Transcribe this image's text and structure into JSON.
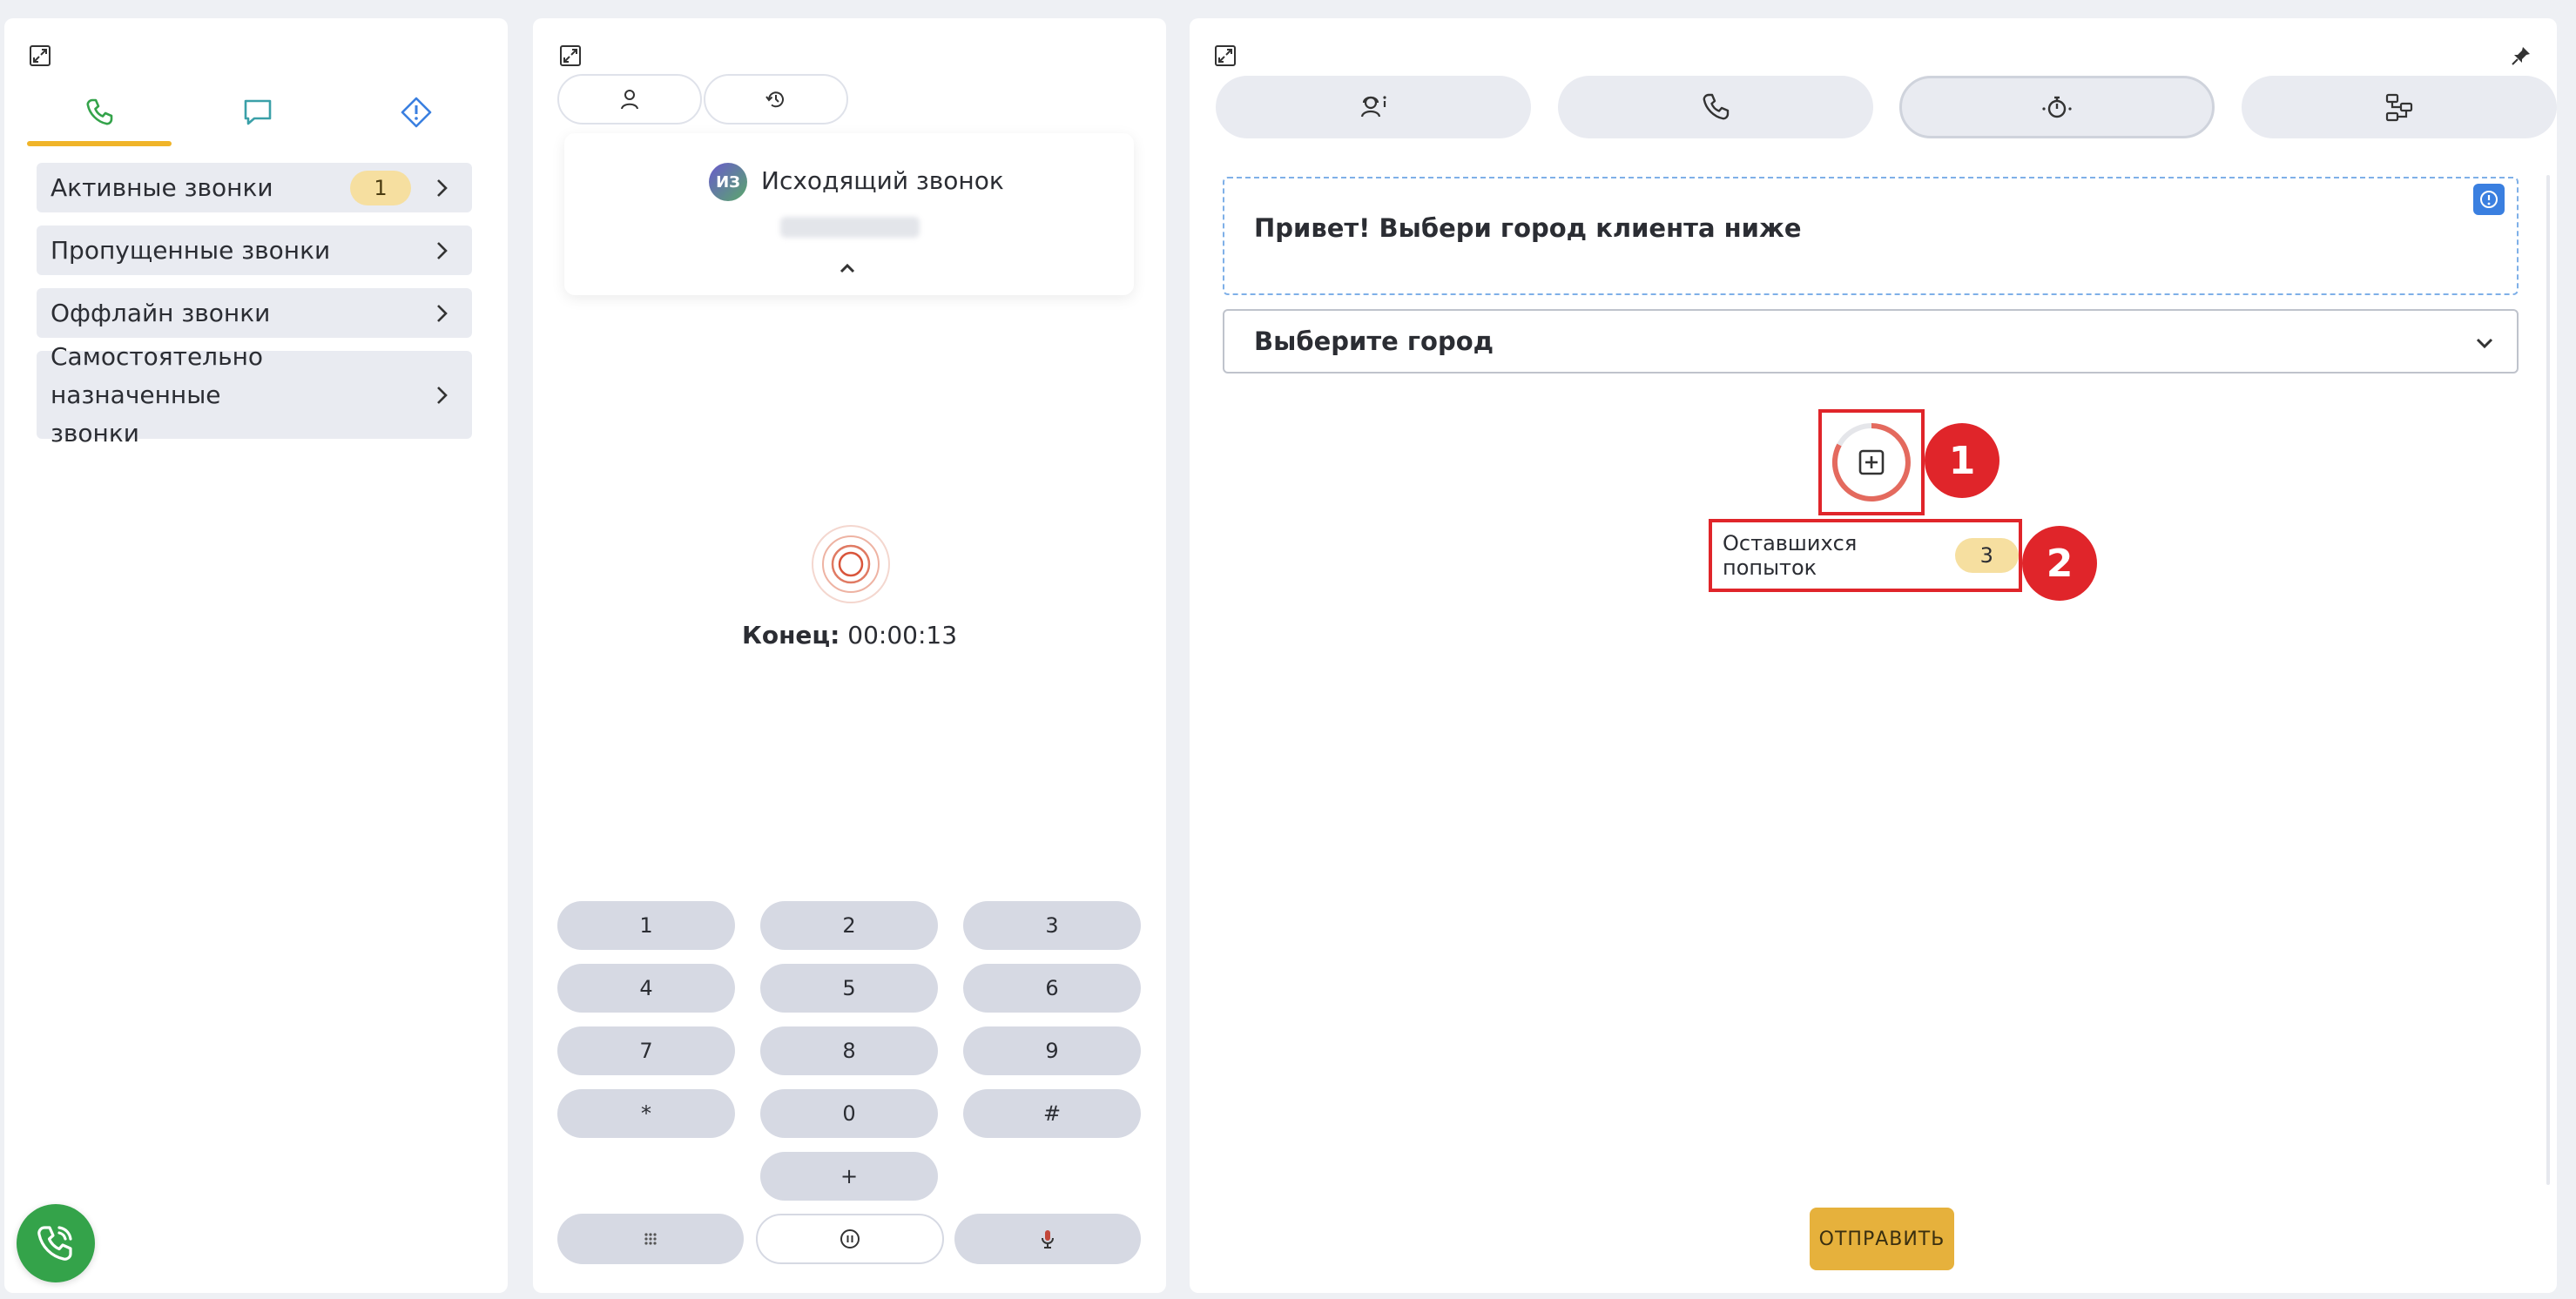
{
  "colors": {
    "accent_yellow": "#f0b429",
    "phone_green": "#34a34a",
    "chat_teal": "#3aa0a8",
    "diamond_blue": "#3a7fe0",
    "annotation_red": "#e0252a",
    "badge_bg": "#f6dfa0",
    "submit_bg": "#e6b13c"
  },
  "left": {
    "tabs": [
      {
        "icon": "phone-icon"
      },
      {
        "icon": "chat-icon"
      },
      {
        "icon": "alert-diamond-icon"
      }
    ],
    "items": [
      {
        "label": "Активные звонки",
        "badge": "1"
      },
      {
        "label": "Пропущенные звонки"
      },
      {
        "label": "Оффлайн звонки"
      },
      {
        "label_line1": "Самостоятельно назначенные",
        "label_line2": "звонки"
      }
    ]
  },
  "mid": {
    "tabs": [
      {
        "icon": "person-icon"
      },
      {
        "icon": "history-icon"
      }
    ],
    "call": {
      "avatar": "ИЗ",
      "title": "Исходящий звонок"
    },
    "end_label": "Конец:",
    "end_time": "00:00:13",
    "keys": [
      "1",
      "2",
      "3",
      "4",
      "5",
      "6",
      "7",
      "8",
      "9",
      "*",
      "0",
      "#",
      "+"
    ]
  },
  "right": {
    "tabs": [
      {
        "icon": "operator-info-icon"
      },
      {
        "icon": "phone-icon"
      },
      {
        "icon": "timer-icon"
      },
      {
        "icon": "flow-icon"
      }
    ],
    "script_text": "Привет! Выбери город клиента ниже",
    "select_placeholder": "Выберите город",
    "attempts_label": "Оставшихся попыток",
    "attempts_count": "3",
    "marker_1": "1",
    "marker_2": "2",
    "submit_label": "ОТПРАВИТЬ"
  }
}
